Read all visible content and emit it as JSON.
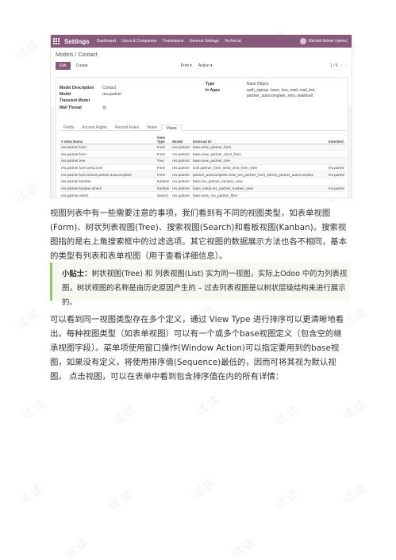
{
  "watermark": "试读",
  "screenshot": {
    "topbar": {
      "app_name": "Settings",
      "menu": [
        "Dashboard",
        "Users & Companies",
        "Translations",
        "General Settings",
        "Technical"
      ],
      "user": "Mitchell Admin (demo)"
    },
    "breadcrumb": {
      "parent": "Models",
      "separator": "/",
      "current": "Contact"
    },
    "buttons": {
      "edit": "Edit",
      "create": "Create",
      "print": "Print ▾",
      "action": "Action ▾"
    },
    "pager": "1 / 6",
    "form": {
      "model_description_label": "Model Description",
      "model_description_value": "Contact",
      "model_label": "Model",
      "model_value": "res.partner",
      "transient_label": "Transient Model",
      "mail_thread_label": "Mail Thread",
      "type_label": "Type",
      "type_value": "Base Object",
      "in_apps_label": "In Apps",
      "in_apps_value": "auth_signup, base, bus, mail, mail_bot, partner_autocomplete, sms, snailmail"
    },
    "tabs": [
      "Fields",
      "Access Rights",
      "Record Rules",
      "Notes",
      "Views"
    ],
    "table": {
      "headers": {
        "name": "View Name",
        "type_line1": "View",
        "type_line2": "Type",
        "model": "Model",
        "external_id": "External ID",
        "inherited": "Inherited"
      },
      "rows": [
        {
          "name": "res.partner.form",
          "type": "Form",
          "model": "res.partner",
          "ext": "base.view_partner_form",
          "inh": ""
        },
        {
          "name": "res.partner.form",
          "type": "Form",
          "model": "res.partner",
          "ext": "base.view_partner_short_form",
          "inh": ""
        },
        {
          "name": "res.partner.tree",
          "type": "Tree",
          "model": "res.partner",
          "ext": "base.view_partner_tree",
          "inh": ""
        },
        {
          "name": "res.partner.form.send.sms",
          "type": "Form",
          "model": "res.partner",
          "ext": "sms.partner_form_send_sms_form_view",
          "inh": "res.partne"
        },
        {
          "name": "res.partner.form.inherit.partner.autocomplete",
          "type": "Form",
          "model": "res.partner",
          "ext": "partner_autocomplete.view_res_partner_form_inherit_partner_autocomplete",
          "inh": "res.partne"
        },
        {
          "name": "res.partner.kanban",
          "type": "Kanban",
          "model": "res.partner",
          "ext": "base.res_partner_kanban_view",
          "inh": ""
        },
        {
          "name": "res.partner.kanban.inherit",
          "type": "Kanban",
          "model": "res.partner",
          "ext": "base_setup.res_partner_kanban_view",
          "inh": "res.partne"
        },
        {
          "name": "res.partner.select",
          "type": "Search",
          "model": "res.partner",
          "ext": "base.view_res_partner_filter",
          "inh": ""
        }
      ]
    }
  },
  "article": {
    "para1": "视图列表中有一些需要注意的事项，我们看到有不同的视图类型，如表单视图(Form)、树状列表视图(Tree)、搜索视图(Search)和看板视图(Kanban)。搜索视图指的是右上角搜索框中的过滤选项。其它视图的数据展示方法也各不相同，基本的类型有列表和表单视图（用于查看详细信息）。",
    "tip_title": "小贴士：",
    "tip_text": "树状视图(Tree) 和 列表视图(List) 实为同一视图，实际上Odoo 中的为列表视图，树状视图的名称是由历史原因产生的 – 过去列表视图是以树状层级结构来进行展示的。",
    "para2": "可以看到同一视图类型存在多个定义，通过 View Type 进行排序可以更清晰地看出。每种视图类型（如表单视图）可以有一个或多个base视图定义（包含空的继承视图字段）。菜单项使用窗口操作(Window Action)可以指定要用到的base视图，如果没有定义，将使用排序值(Sequence)最低的，因而可将其视为默认视图。 点击视图，可以在表单中看到包含排序值在内的所有详情："
  }
}
